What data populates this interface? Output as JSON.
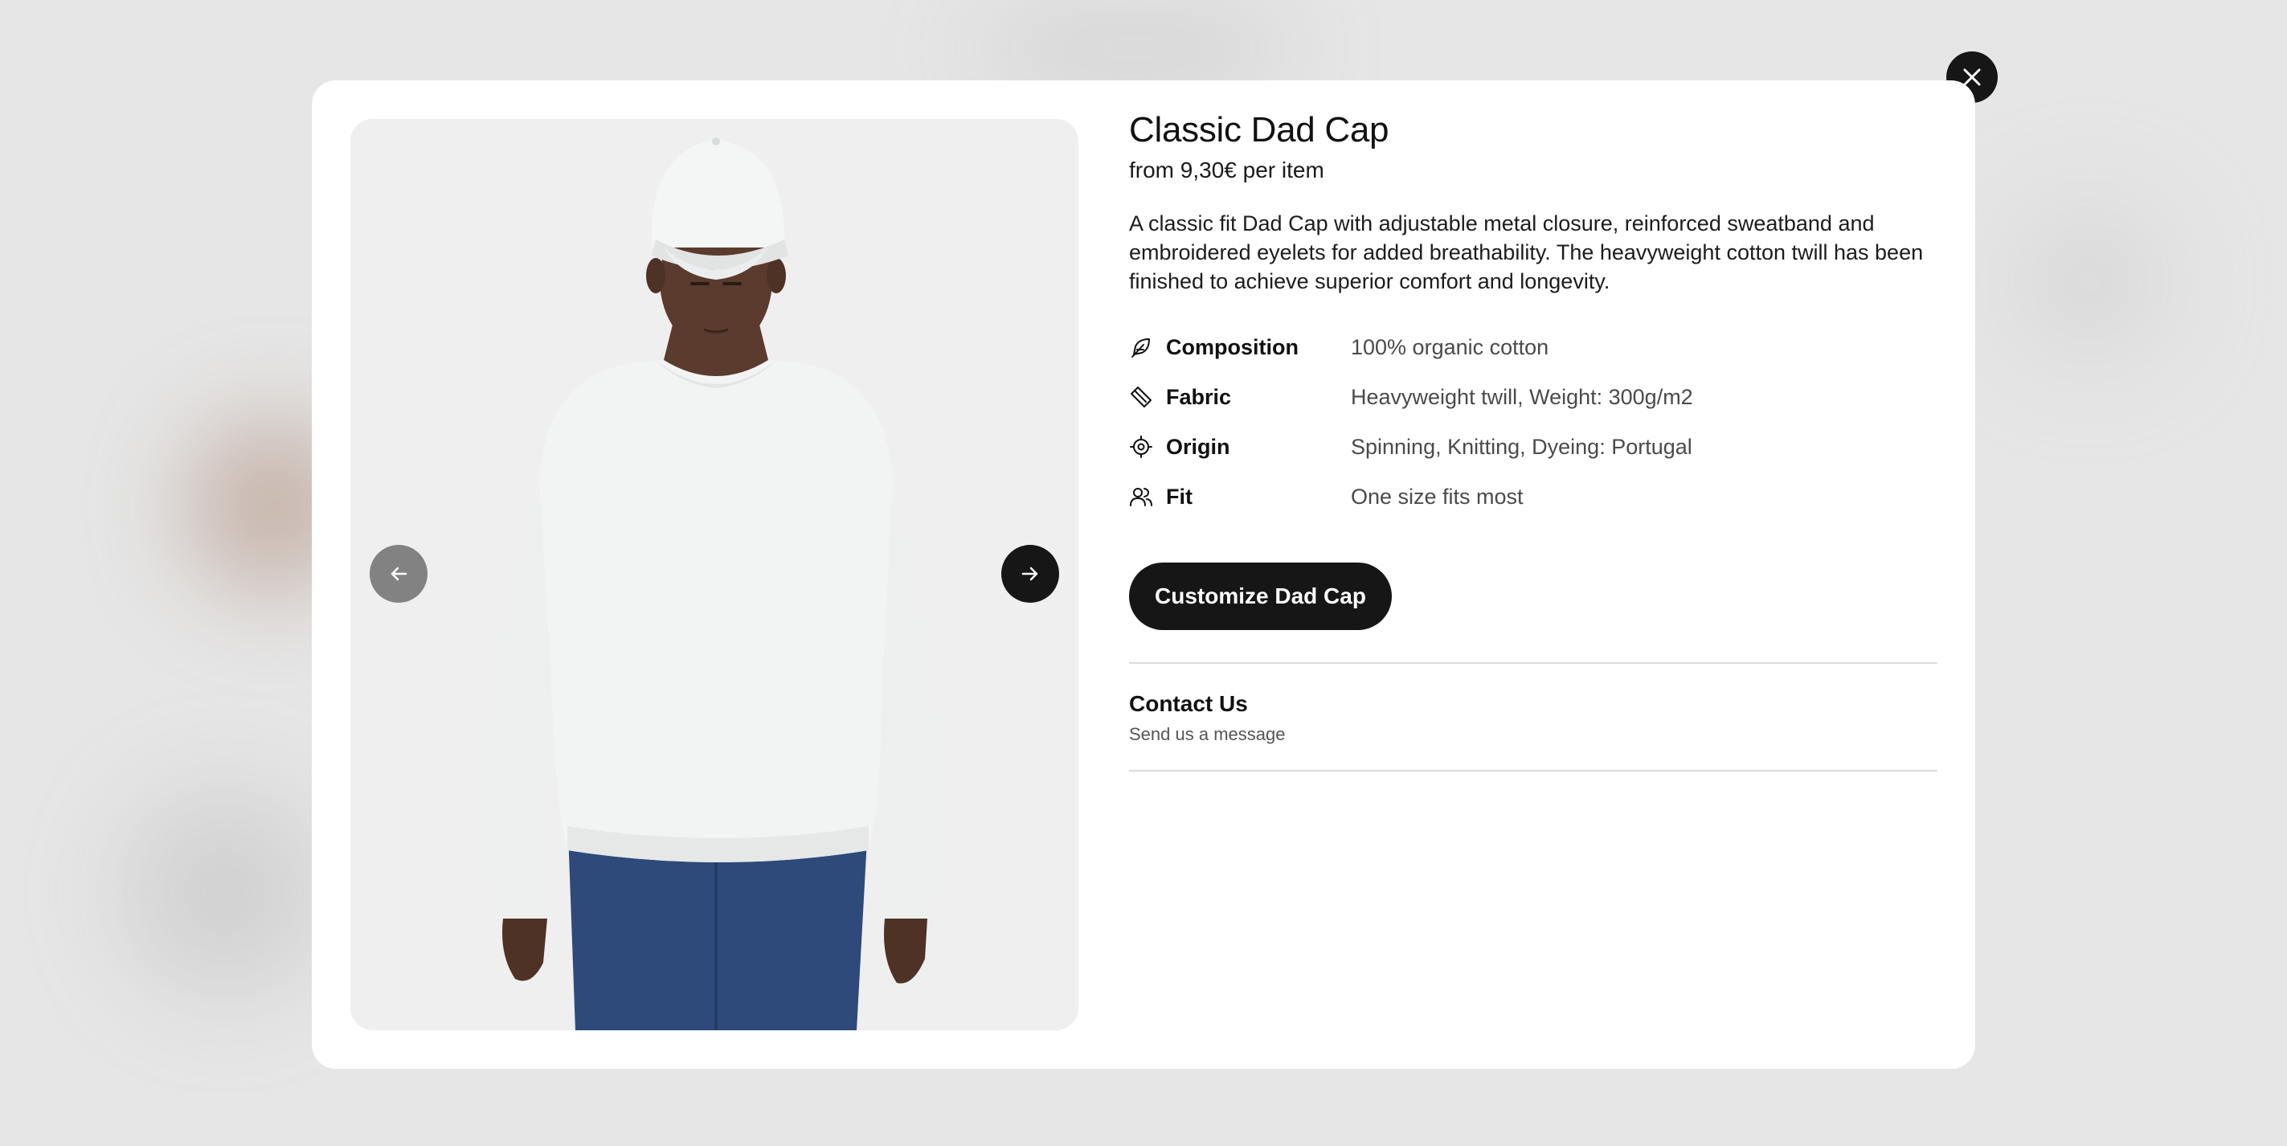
{
  "product": {
    "title": "Classic Dad Cap",
    "price": "from 9,30€ per item",
    "description": "A classic fit Dad Cap with adjustable metal closure, reinforced sweatband and embroidered eyelets for added breathability. The heavyweight cotton twill has been finished to achieve superior comfort and longevity."
  },
  "specs": [
    {
      "icon": "feather-icon",
      "label": "Composition",
      "value": "100% organic cotton"
    },
    {
      "icon": "ruler-icon",
      "label": "Fabric",
      "value": "Heavyweight twill, Weight: 300g/m2"
    },
    {
      "icon": "target-icon",
      "label": "Origin",
      "value": "Spinning, Knitting, Dyeing: Portugal"
    },
    {
      "icon": "users-icon",
      "label": "Fit",
      "value": "One size fits most"
    }
  ],
  "cta": {
    "label": "Customize Dad Cap"
  },
  "contact": {
    "title": "Contact Us",
    "subtitle": "Send us a message"
  },
  "icons": {
    "close": "close-icon",
    "prev": "arrow-left-icon",
    "next": "arrow-right-icon"
  },
  "colors": {
    "dark": "#161616",
    "gallery_bg": "#efefef",
    "sweater": "#f2f3f3",
    "trousers": "#2e4a7a",
    "skin": "#5a3b2e"
  }
}
